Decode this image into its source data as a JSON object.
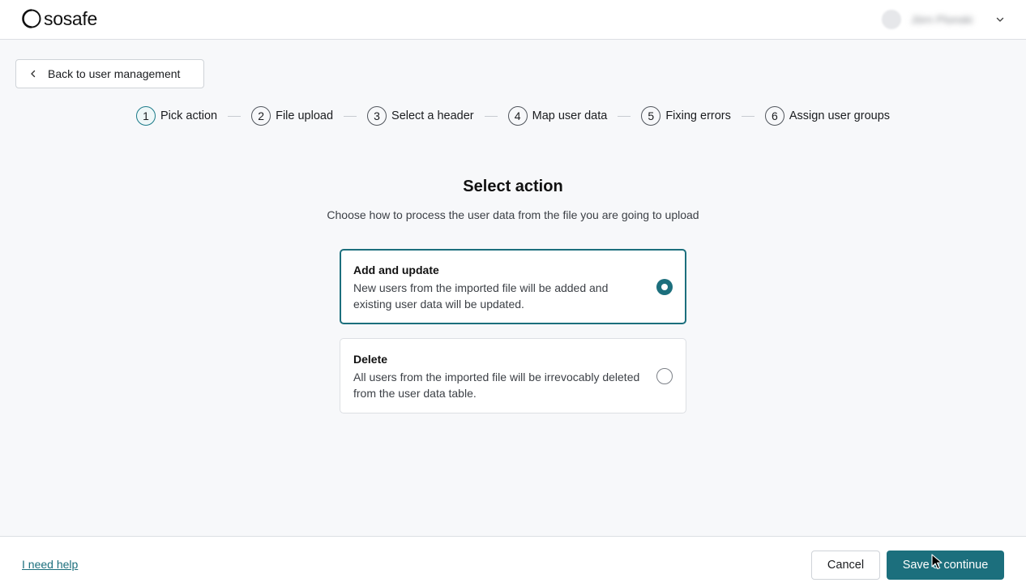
{
  "header": {
    "logo_text": "sosafe",
    "user_name": "Jörn Plonski"
  },
  "back_button": {
    "label": "Back to user management"
  },
  "stepper": {
    "steps": [
      {
        "number": "1",
        "label": "Pick action",
        "active": true
      },
      {
        "number": "2",
        "label": "File upload",
        "active": false
      },
      {
        "number": "3",
        "label": "Select a header",
        "active": false
      },
      {
        "number": "4",
        "label": "Map user data",
        "active": false
      },
      {
        "number": "5",
        "label": "Fixing errors",
        "active": false
      },
      {
        "number": "6",
        "label": "Assign user groups",
        "active": false
      }
    ]
  },
  "main": {
    "title": "Select action",
    "subtitle": "Choose how to process the user data from the file you are going to upload",
    "options": [
      {
        "title": "Add and update",
        "description": "New users from the imported file will be added and existing user data will be updated.",
        "selected": true
      },
      {
        "title": "Delete",
        "description": "All users from the imported file will be irrevocably deleted from the user data table.",
        "selected": false
      }
    ]
  },
  "footer": {
    "help_link": "I need help",
    "cancel_label": "Cancel",
    "save_label": "Save & continue"
  },
  "colors": {
    "accent": "#1c6f7d",
    "background": "#f7f8fa"
  }
}
